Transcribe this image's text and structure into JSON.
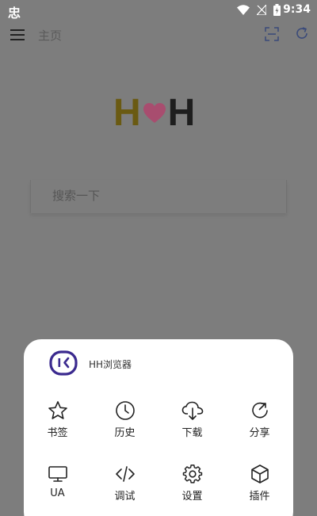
{
  "status_bar": {
    "app_glyph": "忠",
    "time": "9:34"
  },
  "toolbar": {
    "title": "主页"
  },
  "logo": {
    "left_letter": "H",
    "right_letter": "H",
    "left_color": "#6a5a12",
    "heart_color": "#a84d6f",
    "right_color": "#1e1e1e"
  },
  "search": {
    "placeholder": "搜索一下"
  },
  "menu": {
    "app_name": "HH浏览器",
    "accent": "#3b2a8f",
    "items": [
      {
        "icon": "star-icon",
        "label": "书签"
      },
      {
        "icon": "clock-icon",
        "label": "历史"
      },
      {
        "icon": "cloud-download-icon",
        "label": "下载"
      },
      {
        "icon": "share-icon",
        "label": "分享"
      },
      {
        "icon": "monitor-icon",
        "label": "UA"
      },
      {
        "icon": "code-icon",
        "label": "调试"
      },
      {
        "icon": "gear-icon",
        "label": "设置"
      },
      {
        "icon": "cube-icon",
        "label": "插件"
      }
    ]
  }
}
